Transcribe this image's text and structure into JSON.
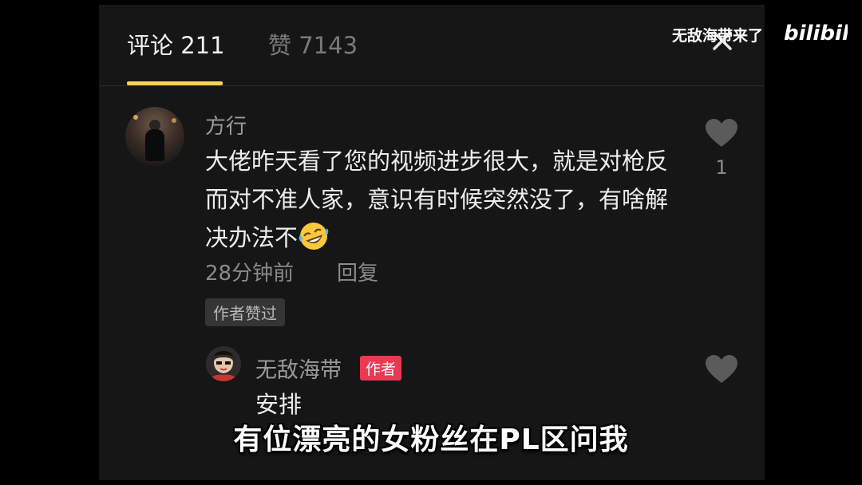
{
  "tabs": {
    "comments_label": "评论 211",
    "likes_label": "赞 7143"
  },
  "comment": {
    "username": "方行",
    "text": "大佬昨天看了您的视频进步很大，就是对枪反而对不准人家，意识有时候突然没了，有啥解决办法不",
    "emoji": "rolling-on-floor-laughing",
    "time": "28分钟前",
    "reply_label": "回复",
    "liked_badge": "作者赞过",
    "like_count": "1"
  },
  "reply": {
    "username": "无敌海带",
    "badge": "作者",
    "text": "安排"
  },
  "overlay": {
    "watermark": "无敌海带来了",
    "logo": "bilibili",
    "subtitle": "有位漂亮的女粉丝在PL区问我"
  },
  "colors": {
    "accent": "#f7d44a",
    "author_badge": "#e83a53",
    "panel_bg": "#161616"
  }
}
